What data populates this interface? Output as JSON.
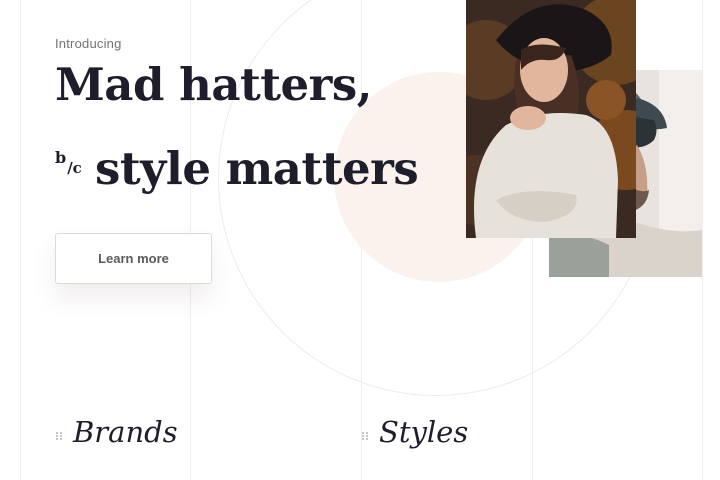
{
  "hero": {
    "eyebrow": "Introducing",
    "headline_line1": "Mad hatters,",
    "bc_top": "b",
    "bc_bottom": "/c",
    "headline_line2": "style matters",
    "cta_label": "Learn more"
  },
  "images": {
    "woman_photo": "woman-in-black-hat-photo",
    "man_photo": "man-in-black-cap-photo"
  },
  "sections": [
    {
      "title": "Brands",
      "icon": "drag-dots-icon"
    },
    {
      "title": "Styles",
      "icon": "drag-dots-icon"
    }
  ],
  "colors": {
    "text": "#1d1d2b",
    "muted": "#777077",
    "accent_blush": "#fbf2ee",
    "button_border": "#e3d6d6"
  }
}
